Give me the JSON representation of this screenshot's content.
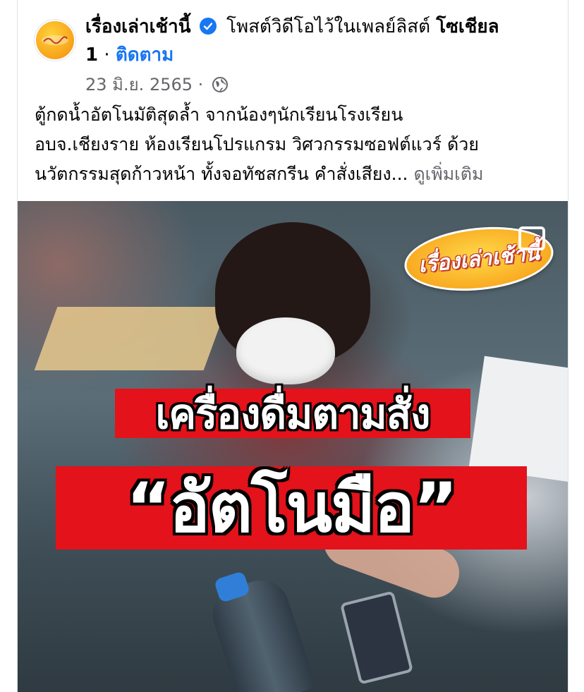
{
  "post": {
    "page_name": "เรื่องเล่าเช้านี้",
    "action_text": "โพสต์วิดีโอไว้ในเพลย์ลิสต์",
    "playlist_name_1": "โซเชียล",
    "playlist_name_2": "1",
    "separator": "·",
    "follow_label": "ติดตาม",
    "date": "23 มิ.ย. 2565",
    "meta_separator": "·",
    "privacy_icon": "globe-icon",
    "caption_lines": [
      "ตู้กดน้ำอัตโนมัติสุดล้ำ จากน้องๆนักเรียนโรงเรียน",
      "อบจ.เชียงราย ห้องเรียนโปรแกรม วิศวกรรมซอฟต์แวร์ ด้วย",
      "นวัตกรรมสุดก้าวหน้า ทั้งจอทัชสกรีน คำสั่งเสียง..."
    ],
    "see_more_label": "ดูเพิ่มเติม"
  },
  "video": {
    "logo_text": "เรื่องเล่าเช้านี้",
    "title_line_1": "เครื่องดื่มตามสั่ง",
    "title_line_2": "“อัตโนมือ”",
    "fullscreen_icon": "fullscreen-icon"
  },
  "colors": {
    "link_blue": "#1877f2",
    "meta_gray": "#65676b",
    "title_red": "#e3121b",
    "logo_yellow": "#f8a51c"
  }
}
